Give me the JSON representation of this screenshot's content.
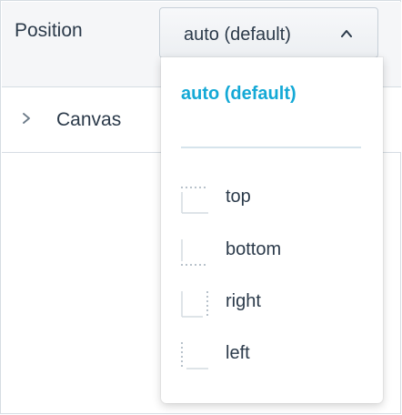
{
  "position_field": {
    "label": "Position",
    "selected_value": "auto (default)"
  },
  "canvas_section": {
    "label": "Canvas"
  },
  "dropdown": {
    "options": [
      {
        "label": "auto (default)",
        "selected": true,
        "icon": "none"
      },
      {
        "label": "top",
        "selected": false,
        "icon": "align-top-icon"
      },
      {
        "label": "bottom",
        "selected": false,
        "icon": "align-bottom-icon"
      },
      {
        "label": "right",
        "selected": false,
        "icon": "align-right-icon"
      },
      {
        "label": "left",
        "selected": false,
        "icon": "align-left-icon"
      }
    ]
  },
  "colors": {
    "accent": "#14a9d6",
    "text": "#2b3a4a",
    "border": "#d6dde3",
    "header_bg": "#f5f6f8"
  }
}
